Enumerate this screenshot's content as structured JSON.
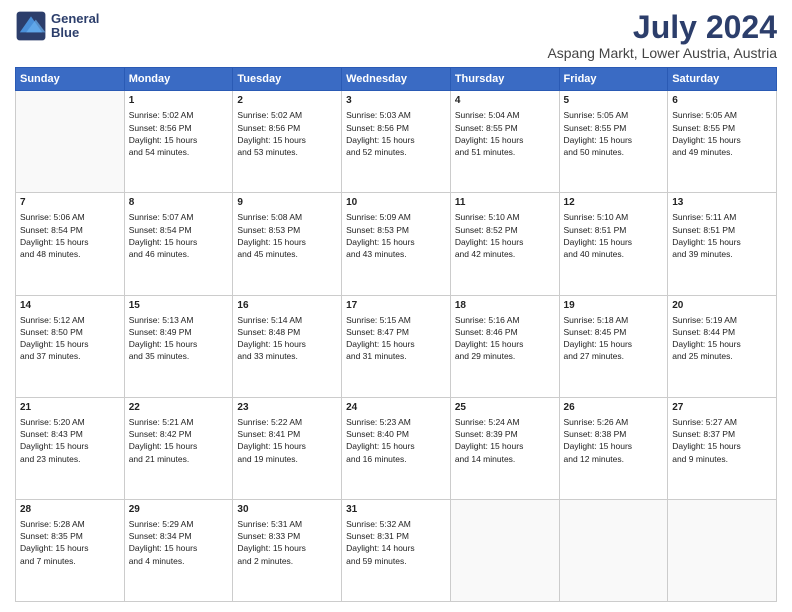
{
  "logo": {
    "line1": "General",
    "line2": "Blue"
  },
  "title": "July 2024",
  "subtitle": "Aspang Markt, Lower Austria, Austria",
  "weekdays": [
    "Sunday",
    "Monday",
    "Tuesday",
    "Wednesday",
    "Thursday",
    "Friday",
    "Saturday"
  ],
  "weeks": [
    [
      {
        "day": "",
        "info": ""
      },
      {
        "day": "1",
        "info": "Sunrise: 5:02 AM\nSunset: 8:56 PM\nDaylight: 15 hours\nand 54 minutes."
      },
      {
        "day": "2",
        "info": "Sunrise: 5:02 AM\nSunset: 8:56 PM\nDaylight: 15 hours\nand 53 minutes."
      },
      {
        "day": "3",
        "info": "Sunrise: 5:03 AM\nSunset: 8:56 PM\nDaylight: 15 hours\nand 52 minutes."
      },
      {
        "day": "4",
        "info": "Sunrise: 5:04 AM\nSunset: 8:55 PM\nDaylight: 15 hours\nand 51 minutes."
      },
      {
        "day": "5",
        "info": "Sunrise: 5:05 AM\nSunset: 8:55 PM\nDaylight: 15 hours\nand 50 minutes."
      },
      {
        "day": "6",
        "info": "Sunrise: 5:05 AM\nSunset: 8:55 PM\nDaylight: 15 hours\nand 49 minutes."
      }
    ],
    [
      {
        "day": "7",
        "info": "Sunrise: 5:06 AM\nSunset: 8:54 PM\nDaylight: 15 hours\nand 48 minutes."
      },
      {
        "day": "8",
        "info": "Sunrise: 5:07 AM\nSunset: 8:54 PM\nDaylight: 15 hours\nand 46 minutes."
      },
      {
        "day": "9",
        "info": "Sunrise: 5:08 AM\nSunset: 8:53 PM\nDaylight: 15 hours\nand 45 minutes."
      },
      {
        "day": "10",
        "info": "Sunrise: 5:09 AM\nSunset: 8:53 PM\nDaylight: 15 hours\nand 43 minutes."
      },
      {
        "day": "11",
        "info": "Sunrise: 5:10 AM\nSunset: 8:52 PM\nDaylight: 15 hours\nand 42 minutes."
      },
      {
        "day": "12",
        "info": "Sunrise: 5:10 AM\nSunset: 8:51 PM\nDaylight: 15 hours\nand 40 minutes."
      },
      {
        "day": "13",
        "info": "Sunrise: 5:11 AM\nSunset: 8:51 PM\nDaylight: 15 hours\nand 39 minutes."
      }
    ],
    [
      {
        "day": "14",
        "info": "Sunrise: 5:12 AM\nSunset: 8:50 PM\nDaylight: 15 hours\nand 37 minutes."
      },
      {
        "day": "15",
        "info": "Sunrise: 5:13 AM\nSunset: 8:49 PM\nDaylight: 15 hours\nand 35 minutes."
      },
      {
        "day": "16",
        "info": "Sunrise: 5:14 AM\nSunset: 8:48 PM\nDaylight: 15 hours\nand 33 minutes."
      },
      {
        "day": "17",
        "info": "Sunrise: 5:15 AM\nSunset: 8:47 PM\nDaylight: 15 hours\nand 31 minutes."
      },
      {
        "day": "18",
        "info": "Sunrise: 5:16 AM\nSunset: 8:46 PM\nDaylight: 15 hours\nand 29 minutes."
      },
      {
        "day": "19",
        "info": "Sunrise: 5:18 AM\nSunset: 8:45 PM\nDaylight: 15 hours\nand 27 minutes."
      },
      {
        "day": "20",
        "info": "Sunrise: 5:19 AM\nSunset: 8:44 PM\nDaylight: 15 hours\nand 25 minutes."
      }
    ],
    [
      {
        "day": "21",
        "info": "Sunrise: 5:20 AM\nSunset: 8:43 PM\nDaylight: 15 hours\nand 23 minutes."
      },
      {
        "day": "22",
        "info": "Sunrise: 5:21 AM\nSunset: 8:42 PM\nDaylight: 15 hours\nand 21 minutes."
      },
      {
        "day": "23",
        "info": "Sunrise: 5:22 AM\nSunset: 8:41 PM\nDaylight: 15 hours\nand 19 minutes."
      },
      {
        "day": "24",
        "info": "Sunrise: 5:23 AM\nSunset: 8:40 PM\nDaylight: 15 hours\nand 16 minutes."
      },
      {
        "day": "25",
        "info": "Sunrise: 5:24 AM\nSunset: 8:39 PM\nDaylight: 15 hours\nand 14 minutes."
      },
      {
        "day": "26",
        "info": "Sunrise: 5:26 AM\nSunset: 8:38 PM\nDaylight: 15 hours\nand 12 minutes."
      },
      {
        "day": "27",
        "info": "Sunrise: 5:27 AM\nSunset: 8:37 PM\nDaylight: 15 hours\nand 9 minutes."
      }
    ],
    [
      {
        "day": "28",
        "info": "Sunrise: 5:28 AM\nSunset: 8:35 PM\nDaylight: 15 hours\nand 7 minutes."
      },
      {
        "day": "29",
        "info": "Sunrise: 5:29 AM\nSunset: 8:34 PM\nDaylight: 15 hours\nand 4 minutes."
      },
      {
        "day": "30",
        "info": "Sunrise: 5:31 AM\nSunset: 8:33 PM\nDaylight: 15 hours\nand 2 minutes."
      },
      {
        "day": "31",
        "info": "Sunrise: 5:32 AM\nSunset: 8:31 PM\nDaylight: 14 hours\nand 59 minutes."
      },
      {
        "day": "",
        "info": ""
      },
      {
        "day": "",
        "info": ""
      },
      {
        "day": "",
        "info": ""
      }
    ]
  ]
}
